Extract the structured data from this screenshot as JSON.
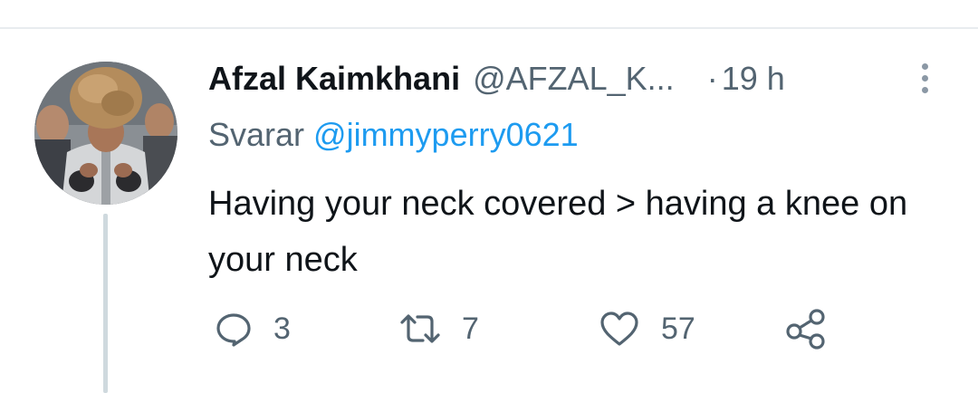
{
  "tweet": {
    "display_name": "Afzal Kaimkhani",
    "handle": "@AFZAL_K...",
    "separator": "·",
    "time": "19 h",
    "reply_prefix": "Svarar",
    "reply_to": "@jimmyperry0621",
    "text": "Having your neck covered > having a knee on your neck"
  },
  "actions": {
    "reply_count": "3",
    "retweet_count": "7",
    "like_count": "57"
  },
  "colors": {
    "text_primary": "#0f1419",
    "text_secondary": "#536471",
    "accent": "#1d9bf0",
    "thread_line": "#cfd9de"
  },
  "icons": {
    "more": "more-vertical-icon",
    "reply": "reply-icon",
    "retweet": "retweet-icon",
    "like": "heart-icon",
    "share": "share-icon"
  }
}
